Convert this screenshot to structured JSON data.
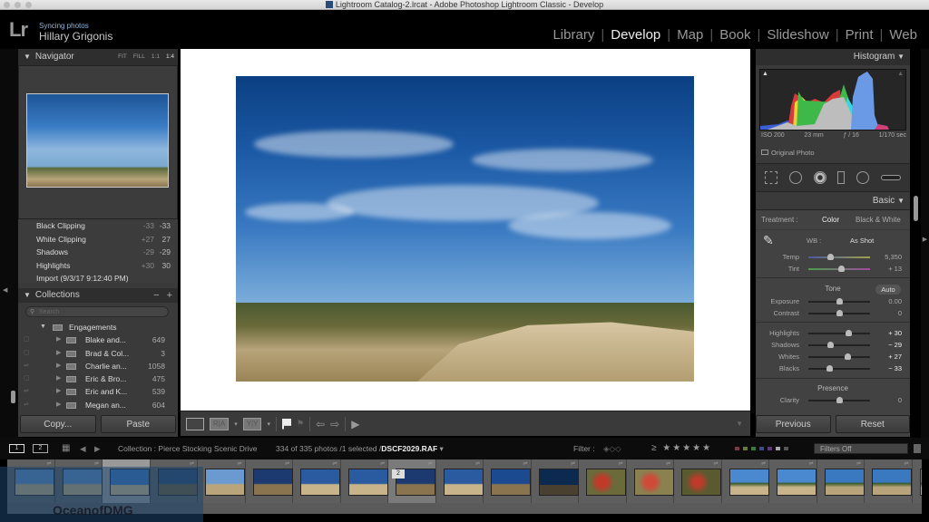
{
  "window": {
    "title": "Lightroom Catalog-2.lrcat - Adobe Photoshop Lightroom Classic - Develop"
  },
  "identity": {
    "logo": "Lr",
    "sync_status": "Syncing photos",
    "user": "Hillary Grigonis"
  },
  "modules": [
    {
      "label": "Library",
      "active": false
    },
    {
      "label": "Develop",
      "active": true
    },
    {
      "label": "Map",
      "active": false
    },
    {
      "label": "Book",
      "active": false
    },
    {
      "label": "Slideshow",
      "active": false
    },
    {
      "label": "Print",
      "active": false
    },
    {
      "label": "Web",
      "active": false
    }
  ],
  "navigator": {
    "title": "Navigator",
    "zoom_options": [
      "FIT",
      "FILL",
      "1:1",
      "1:4"
    ],
    "zoom_selected": "1:4"
  },
  "history": [
    {
      "label": "Black Clipping",
      "delta": "-33",
      "value": "-33"
    },
    {
      "label": "White Clipping",
      "delta": "+27",
      "value": "27"
    },
    {
      "label": "Shadows",
      "delta": "-29",
      "value": "-29"
    },
    {
      "label": "Highlights",
      "delta": "+30",
      "value": "30"
    },
    {
      "label": "Import (9/3/17 9:12:40 PM)",
      "delta": "",
      "value": ""
    }
  ],
  "collections": {
    "title": "Collections",
    "minus": "−",
    "plus": "+",
    "search_placeholder": "Search",
    "parent": "Engagements",
    "items": [
      {
        "name": "Blake and...",
        "count": "649"
      },
      {
        "name": "Brad & Col...",
        "count": "3"
      },
      {
        "name": "Charlie an...",
        "count": "1058"
      },
      {
        "name": "Eric & Bro...",
        "count": "475"
      },
      {
        "name": "Eric and K...",
        "count": "539"
      },
      {
        "name": "Megan an...",
        "count": "604"
      }
    ]
  },
  "left_buttons": {
    "copy": "Copy...",
    "paste": "Paste"
  },
  "right_buttons": {
    "previous": "Previous",
    "reset": "Reset"
  },
  "histogram": {
    "title": "Histogram",
    "iso": "ISO 200",
    "focal": "23 mm",
    "aperture": "ƒ / 16",
    "shutter": "1/170 sec",
    "original_photo": "Original Photo"
  },
  "basic": {
    "title": "Basic",
    "treatment_label": "Treatment :",
    "treatment_color": "Color",
    "treatment_bw": "Black & White",
    "wb_label": "WB :",
    "wb_value": "As Shot",
    "tone_title": "Tone",
    "auto": "Auto",
    "presence_title": "Presence",
    "sliders": {
      "temp": {
        "label": "Temp",
        "value": "5,350",
        "position": 0.35
      },
      "tint": {
        "label": "Tint",
        "value": "+ 13",
        "position": 0.53
      },
      "exposure": {
        "label": "Exposure",
        "value": "0.00",
        "position": 0.5
      },
      "contrast": {
        "label": "Contrast",
        "value": "0",
        "position": 0.5
      },
      "highlights": {
        "label": "Highlights",
        "value": "+ 30",
        "position": 0.65
      },
      "shadows": {
        "label": "Shadows",
        "value": "− 29",
        "position": 0.36
      },
      "whites": {
        "label": "Whites",
        "value": "+ 27",
        "position": 0.63
      },
      "blacks": {
        "label": "Blacks",
        "value": "− 33",
        "position": 0.34
      },
      "clarity": {
        "label": "Clarity",
        "value": "0",
        "position": 0.5
      }
    }
  },
  "toolbar": {
    "view_loupe": "",
    "before_after_1": "R|A",
    "before_after_2": "Y|Y"
  },
  "filmstrip_bar": {
    "screen1": "1",
    "screen2": "2",
    "collection": "Collection : Pierce Stocking Scenic Drive",
    "count_prefix": "334 of 335 photos /1 selected /",
    "filename": "DSCF2029.RAF",
    "filter_label": "Filter :",
    "stars": "≥ ★★★★★",
    "filter_select": "Filters Off"
  },
  "filmstrip": {
    "selected_badge": "2"
  },
  "colors": {
    "background": "#000000",
    "panel": "#3a3a3a",
    "accent_text": "#eeeeee",
    "sync_blue": "#8fb8e0"
  }
}
